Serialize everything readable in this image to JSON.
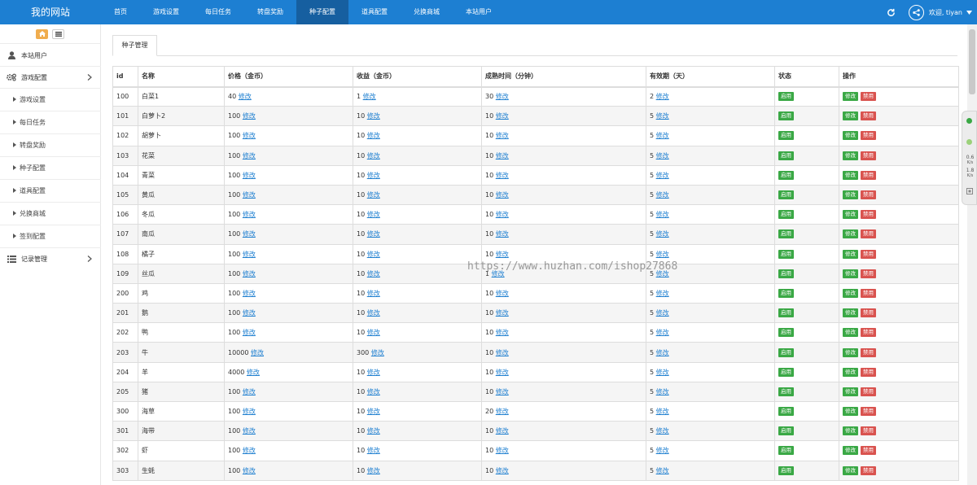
{
  "header": {
    "brand": "我的网站",
    "nav": [
      {
        "label": "首页"
      },
      {
        "label": "游戏设置"
      },
      {
        "label": "每日任务"
      },
      {
        "label": "转盘奖励"
      },
      {
        "label": "种子配置"
      },
      {
        "label": "道具配置"
      },
      {
        "label": "兑换商城"
      },
      {
        "label": "本站用户"
      }
    ],
    "active_nav": "种子配置",
    "welcome": "欢迎, tiyan"
  },
  "sidebar": {
    "user_item": "本站用户",
    "game_config": "游戏配置",
    "sub_items": [
      "游戏设置",
      "每日任务",
      "转盘奖励",
      "种子配置",
      "道具配置",
      "兑换商城",
      "签到配置"
    ],
    "records": "记录管理"
  },
  "tab": {
    "label": "种子管理"
  },
  "table": {
    "headers": [
      "id",
      "名称",
      "价格（金币）",
      "收益（金币）",
      "成熟时间（分钟）",
      "有效期（天）",
      "状态",
      "操作"
    ],
    "edit_link": "修改",
    "status_label": "启用",
    "op_edit": "修改",
    "op_disable": "禁用",
    "rows": [
      {
        "id": "100",
        "name": "白菜1",
        "price": "40",
        "income": "1",
        "time": "30",
        "valid": "2"
      },
      {
        "id": "101",
        "name": "白萝卜2",
        "price": "100",
        "income": "10",
        "time": "10",
        "valid": "5"
      },
      {
        "id": "102",
        "name": "胡萝卜",
        "price": "100",
        "income": "10",
        "time": "10",
        "valid": "5"
      },
      {
        "id": "103",
        "name": "花菜",
        "price": "100",
        "income": "10",
        "time": "10",
        "valid": "5"
      },
      {
        "id": "104",
        "name": "青菜",
        "price": "100",
        "income": "10",
        "time": "10",
        "valid": "5"
      },
      {
        "id": "105",
        "name": "黄瓜",
        "price": "100",
        "income": "10",
        "time": "10",
        "valid": "5"
      },
      {
        "id": "106",
        "name": "冬瓜",
        "price": "100",
        "income": "10",
        "time": "10",
        "valid": "5"
      },
      {
        "id": "107",
        "name": "南瓜",
        "price": "100",
        "income": "10",
        "time": "10",
        "valid": "5"
      },
      {
        "id": "108",
        "name": "橘子",
        "price": "100",
        "income": "10",
        "time": "10",
        "valid": "5"
      },
      {
        "id": "109",
        "name": "丝瓜",
        "price": "100",
        "income": "10",
        "time": "1",
        "valid": "5"
      },
      {
        "id": "200",
        "name": "鸡",
        "price": "100",
        "income": "10",
        "time": "10",
        "valid": "5"
      },
      {
        "id": "201",
        "name": "鹅",
        "price": "100",
        "income": "10",
        "time": "10",
        "valid": "5"
      },
      {
        "id": "202",
        "name": "鸭",
        "price": "100",
        "income": "10",
        "time": "10",
        "valid": "5"
      },
      {
        "id": "203",
        "name": "牛",
        "price": "10000",
        "income": "300",
        "time": "10",
        "valid": "5"
      },
      {
        "id": "204",
        "name": "羊",
        "price": "4000",
        "income": "10",
        "time": "10",
        "valid": "5"
      },
      {
        "id": "205",
        "name": "猪",
        "price": "100",
        "income": "10",
        "time": "10",
        "valid": "5"
      },
      {
        "id": "300",
        "name": "海草",
        "price": "100",
        "income": "10",
        "time": "20",
        "valid": "5"
      },
      {
        "id": "301",
        "name": "海带",
        "price": "100",
        "income": "10",
        "time": "10",
        "valid": "5"
      },
      {
        "id": "302",
        "name": "虾",
        "price": "100",
        "income": "10",
        "time": "10",
        "valid": "5"
      },
      {
        "id": "303",
        "name": "生蚝",
        "price": "100",
        "income": "10",
        "time": "10",
        "valid": "5"
      }
    ]
  },
  "float_widget": {
    "v1": "0.6",
    "u1": "K/s",
    "v2": "1.8",
    "u2": "K/s"
  },
  "watermark": "https://www.huzhan.com/ishop27868",
  "colors": {
    "topbar": "#1d7fd2",
    "active_nav": "#165fa0",
    "link": "#1e7fd0",
    "green": "#3aa845",
    "red": "#d9534f",
    "orange": "#f0ad4e"
  }
}
